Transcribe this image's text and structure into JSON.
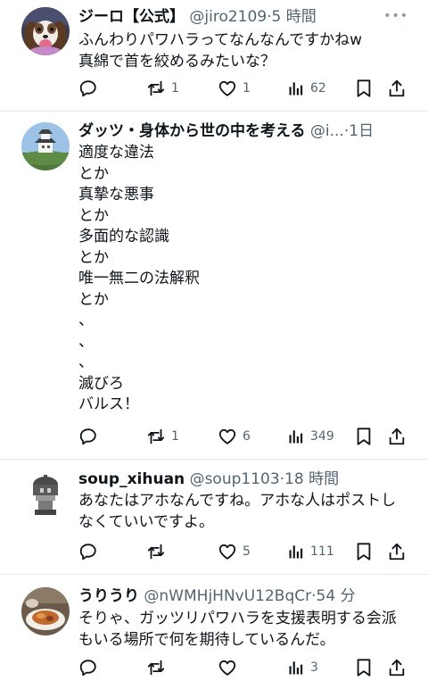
{
  "posts": [
    {
      "name": "ジーロ【公式】",
      "handle": "@jiro2109",
      "time": "·5 時間",
      "text": "ふんわりパワハラってなんなんですかねw\n真綿で首を絞めるみたいな？",
      "replies": "",
      "reposts": "1",
      "likes": "1",
      "views": "62"
    },
    {
      "name": "ダッツ・身体から世の中を考える",
      "handle": "@i...",
      "time": "·1日",
      "text": "適度な違法\nとか\n真摯な悪事\nとか\n多面的な認識\nとか\n唯一無二の法解釈\nとか\n、\n、\n、\n滅びろ\nバルス！",
      "replies": "",
      "reposts": "1",
      "likes": "6",
      "views": "349"
    },
    {
      "name": "soup_xihuan",
      "handle": "@soup1103",
      "time": "·18 時間",
      "text": "あなたはアホなんですね。アホな人はポストし\nなくていいですよ。",
      "replies": "",
      "reposts": "",
      "likes": "5",
      "views": "111"
    },
    {
      "name": "うりうり",
      "handle": "@nWMHjHNvU12BqCr",
      "time": "·54 分",
      "text": "そりゃ、ガッツリパワハラを支援表明する会派\nもいる場所で何を期待しているんだ。",
      "replies": "",
      "reposts": "",
      "likes": "",
      "views": "3"
    }
  ],
  "more_label": "•••",
  "icons": {
    "reply": "reply-icon",
    "repost": "repost-icon",
    "like": "heart-icon",
    "views": "views-chart-icon",
    "bookmark": "bookmark-icon",
    "share": "share-icon"
  },
  "colors": {
    "text": "#0f1419",
    "secondary": "#536471",
    "divider": "#e6e8ea"
  }
}
